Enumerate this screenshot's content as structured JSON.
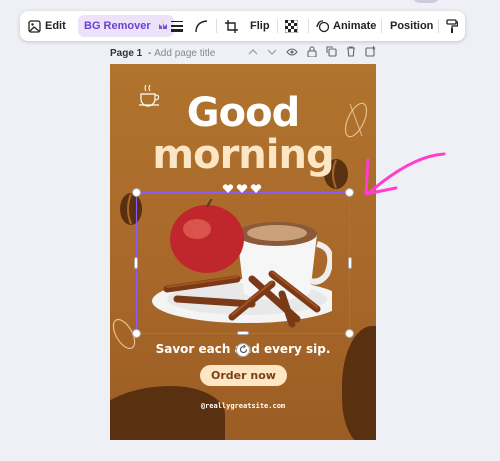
{
  "toolbar": {
    "edit_label": "Edit",
    "bg_remover_label": "BG Remover",
    "flip_label": "Flip",
    "animate_label": "Animate",
    "position_label": "Position"
  },
  "page": {
    "title": "Page 1",
    "separator": " - ",
    "placeholder": "Add page title"
  },
  "design": {
    "headline_line1": "Good",
    "headline_line2": "morning",
    "tagline": "Savor each and every sip.",
    "cta_label": "Order now",
    "website": "@reallygreatsite.com"
  },
  "colors": {
    "accent": "#8b5cf6",
    "background": "#eef0f5",
    "canvas": "#a9682a",
    "headline_cream": "#fde6c4",
    "annotation_arrow": "#ff3dcf"
  },
  "icons": [
    "image-edit-icon",
    "crown-icon",
    "line-weight-icon",
    "corner-radius-icon",
    "crop-icon",
    "transparency-icon",
    "animate-icon",
    "paint-roller-icon",
    "chevron-up-icon",
    "chevron-down-icon",
    "eye-icon",
    "lock-icon",
    "copy-icon",
    "trash-icon",
    "add-page-icon",
    "rotate-icon",
    "pink-arrow-icon"
  ]
}
